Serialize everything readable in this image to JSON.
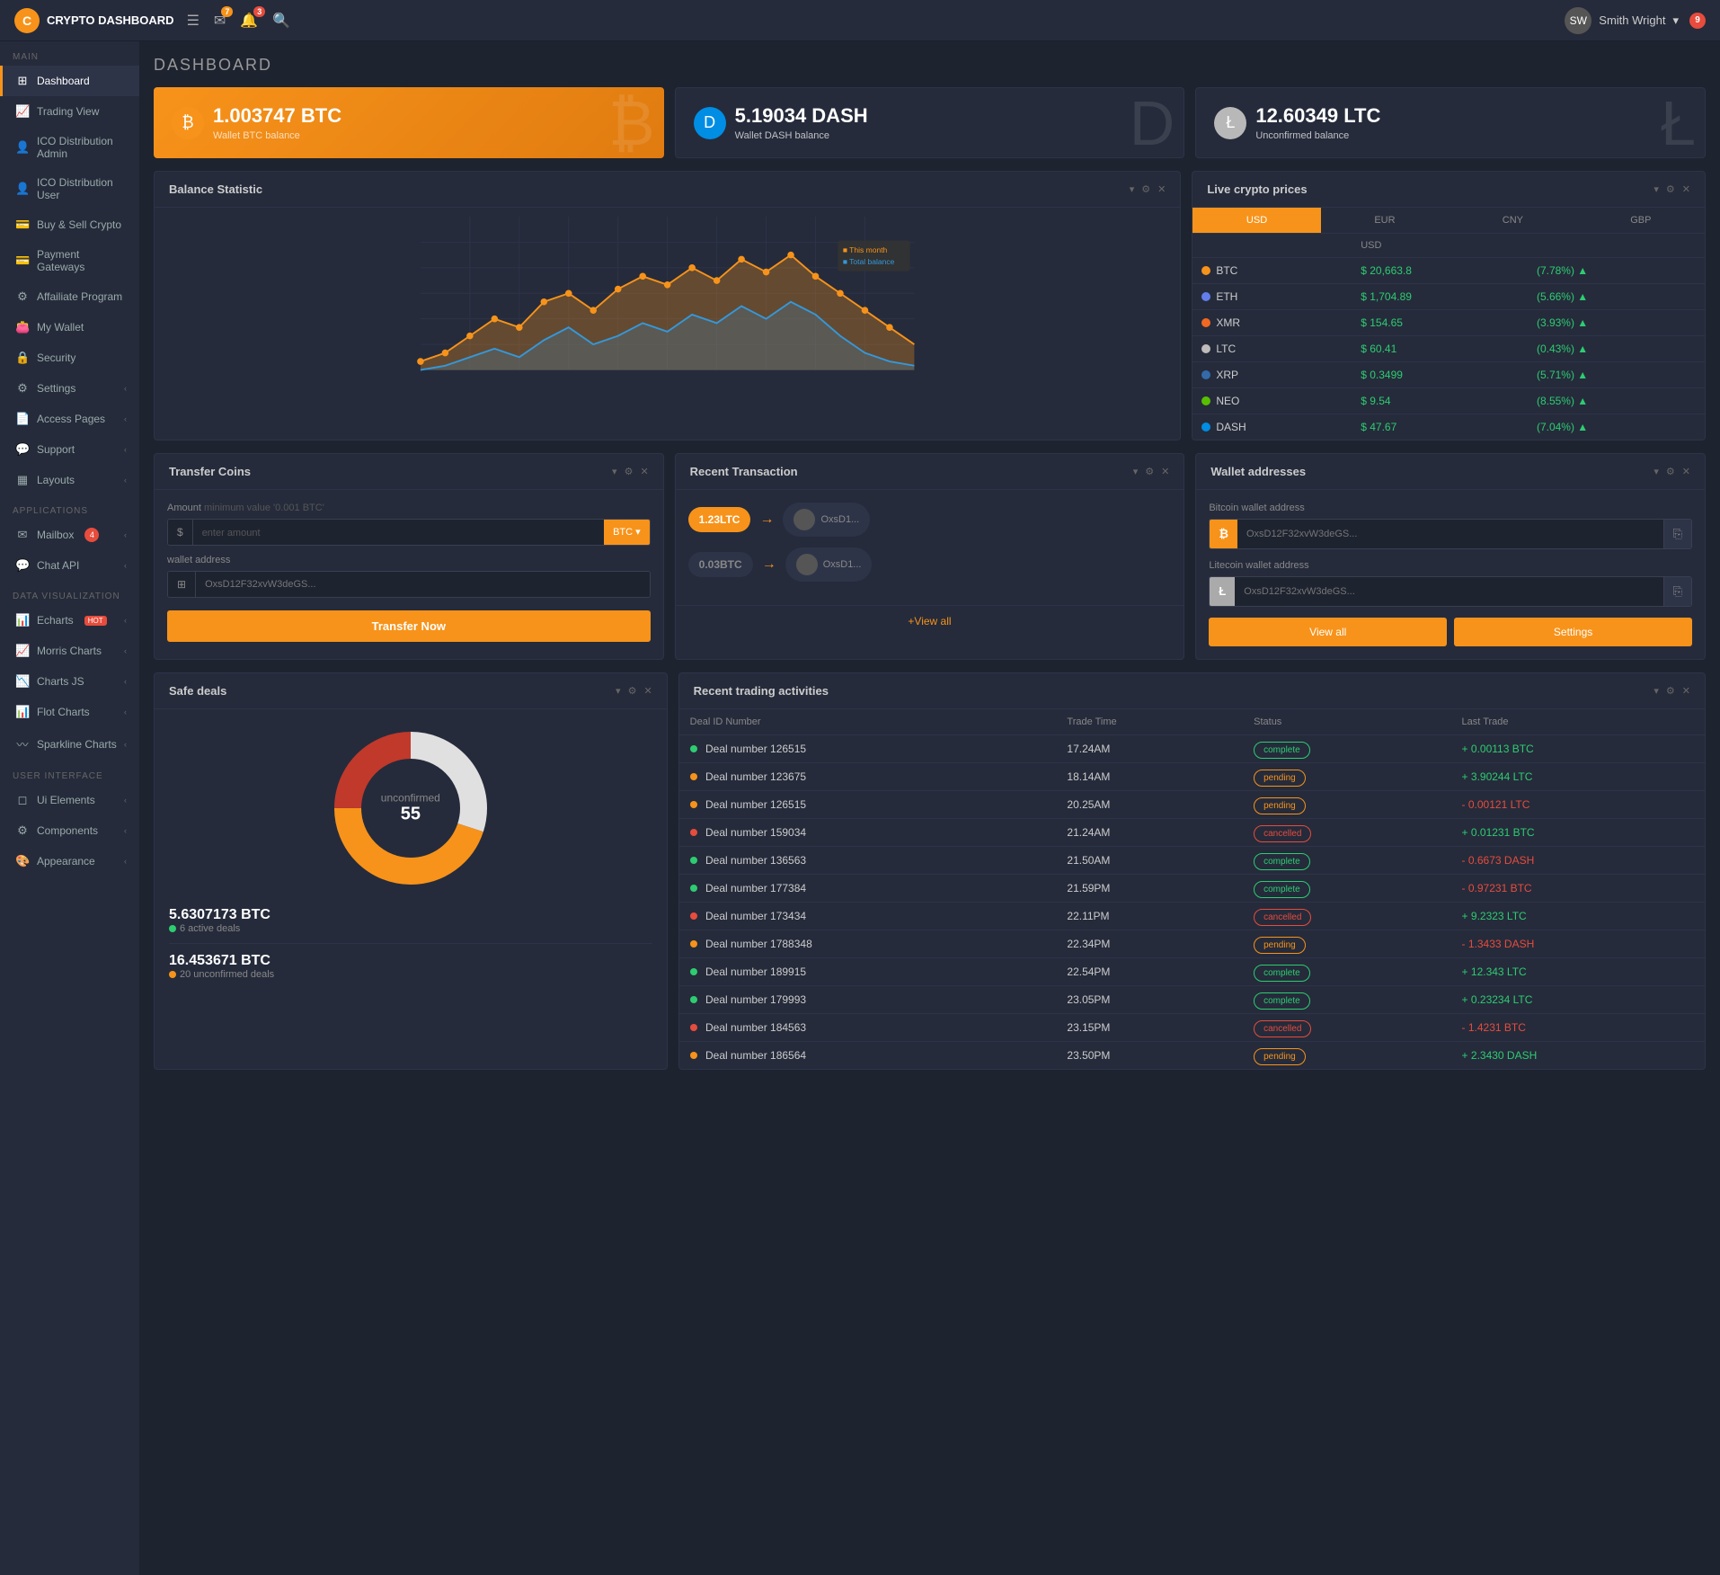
{
  "brand": {
    "name": "CRYPTO DASHBOARD",
    "icon": "C"
  },
  "topnav": {
    "menu_icon": "☰",
    "email_badge": "7",
    "bell_badge": "3",
    "search_icon": "🔍",
    "user_name": "Smith Wright",
    "chat_badge": "9"
  },
  "sidebar": {
    "sections": [
      {
        "label": "MAIN",
        "items": [
          {
            "id": "dashboard",
            "label": "Dashboard",
            "icon": "⊞",
            "active": true
          },
          {
            "id": "trading-view",
            "label": "Trading View",
            "icon": "📈"
          },
          {
            "id": "ico-admin",
            "label": "ICO Distribution Admin",
            "icon": "👤"
          },
          {
            "id": "ico-user",
            "label": "ICO Distribution User",
            "icon": "👤"
          },
          {
            "id": "buy-sell",
            "label": "Buy & Sell Crypto",
            "icon": "💳"
          },
          {
            "id": "payment-gateways",
            "label": "Payment Gateways",
            "icon": "💳"
          },
          {
            "id": "affiliate",
            "label": "Affailiate Program",
            "icon": "⚙"
          },
          {
            "id": "my-wallet",
            "label": "My Wallet",
            "icon": "👛"
          },
          {
            "id": "security",
            "label": "Security",
            "icon": "🔒"
          },
          {
            "id": "settings",
            "label": "Settings",
            "icon": "⚙",
            "has_arrow": true
          },
          {
            "id": "access-pages",
            "label": "Access Pages",
            "icon": "📄",
            "has_arrow": true
          },
          {
            "id": "support",
            "label": "Support",
            "icon": "💬",
            "has_arrow": true
          },
          {
            "id": "layouts",
            "label": "Layouts",
            "icon": "▦",
            "has_arrow": true
          }
        ]
      },
      {
        "label": "APPLICATIONS",
        "items": [
          {
            "id": "mailbox",
            "label": "Mailbox",
            "icon": "✉",
            "badge": "4",
            "has_arrow": true
          },
          {
            "id": "chat-api",
            "label": "Chat API",
            "icon": "💬",
            "has_arrow": true
          }
        ]
      },
      {
        "label": "DATA VISUALIZATION",
        "items": [
          {
            "id": "echarts",
            "label": "Echarts",
            "icon": "📊",
            "hot": true,
            "has_arrow": true
          },
          {
            "id": "morris-charts",
            "label": "Morris Charts",
            "icon": "📈",
            "has_arrow": true
          },
          {
            "id": "charts-js",
            "label": "Charts JS",
            "icon": "📉",
            "has_arrow": true
          },
          {
            "id": "flot-charts",
            "label": "Flot Charts",
            "icon": "📊",
            "has_arrow": true
          },
          {
            "id": "sparkline-charts",
            "label": "Sparkline Charts",
            "icon": "〰",
            "has_arrow": true
          }
        ]
      },
      {
        "label": "USER INTERFACE",
        "items": [
          {
            "id": "ui-elements",
            "label": "Ui Elements",
            "icon": "◻",
            "has_arrow": true
          },
          {
            "id": "components",
            "label": "Components",
            "icon": "⚙",
            "has_arrow": true
          },
          {
            "id": "appearance",
            "label": "Appearance",
            "icon": "🎨",
            "has_arrow": true
          }
        ]
      }
    ]
  },
  "page": {
    "title": "DASHBOARD"
  },
  "stat_cards": [
    {
      "id": "btc",
      "type": "orange",
      "value": "1.003747 BTC",
      "label": "Wallet BTC balance",
      "icon": "₿",
      "bg_icon": "₿"
    },
    {
      "id": "dash",
      "type": "dark",
      "value": "5.19034 DASH",
      "label": "Wallet DASH balance",
      "icon": "D",
      "bg_icon": "D"
    },
    {
      "id": "ltc",
      "type": "dark",
      "value": "12.60349 LTC",
      "label": "Unconfirmed balance",
      "icon": "Ł",
      "bg_icon": "Ł"
    }
  ],
  "balance_statistic": {
    "title": "Balance Statistic",
    "legend": {
      "this_month": "This month",
      "total_balance": "Total balance"
    },
    "controls": [
      "▾",
      "⚙",
      "✕"
    ]
  },
  "live_crypto": {
    "title": "Live crypto prices",
    "tabs": [
      "USD",
      "EUR",
      "CNY",
      "GBP"
    ],
    "active_tab": "USD",
    "columns": [
      "",
      "USD",
      ""
    ],
    "coins": [
      {
        "id": "btc",
        "name": "BTC",
        "dot": "dot-btc",
        "price": "$ 20,663.8",
        "change": "(7.78%) ▲",
        "positive": true
      },
      {
        "id": "eth",
        "name": "ETH",
        "dot": "dot-eth",
        "price": "$ 1,704.89",
        "change": "(5.66%) ▲",
        "positive": true
      },
      {
        "id": "xmr",
        "name": "XMR",
        "dot": "dot-xmr",
        "price": "$ 154.65",
        "change": "(3.93%) ▲",
        "positive": true
      },
      {
        "id": "ltc",
        "name": "LTC",
        "dot": "dot-ltc",
        "price": "$ 60.41",
        "change": "(0.43%) ▲",
        "positive": true
      },
      {
        "id": "xrp",
        "name": "XRP",
        "dot": "dot-xrp",
        "price": "$ 0.3499",
        "change": "(5.71%) ▲",
        "positive": true
      },
      {
        "id": "neo",
        "name": "NEO",
        "dot": "dot-neo",
        "price": "$ 9.54",
        "change": "(8.55%) ▲",
        "positive": true
      },
      {
        "id": "dash",
        "name": "DASH",
        "dot": "dot-dash",
        "price": "$ 47.67",
        "change": "(7.04%) ▲",
        "positive": true
      }
    ]
  },
  "transfer_coins": {
    "title": "Transfer Coins",
    "amount_label": "Amount",
    "amount_hint": "minimum value '0.001 BTC'",
    "prefix": "$",
    "placeholder": "enter amount",
    "currency": "BTC ▾",
    "wallet_placeholder": "OxsD12F32xvW3deGS...",
    "button": "Transfer Now"
  },
  "recent_transaction": {
    "title": "Recent Transaction",
    "transactions": [
      {
        "amount": "1.23LTC",
        "to": "OxsD1..."
      },
      {
        "amount": "0.03BTC",
        "to": "OxsD1..."
      }
    ],
    "view_all": "+View all"
  },
  "wallet_addresses": {
    "title": "Wallet addresses",
    "btc_label": "Bitcoin wallet address",
    "btc_address": "OxsD12F32xvW3deGS...",
    "ltc_label": "Litecoin wallet address",
    "ltc_address": "OxsD12F32xvW3deGS...",
    "view_all": "View all",
    "settings": "Settings"
  },
  "safe_deals": {
    "title": "Safe deals",
    "donut_label": "unconfirmed",
    "donut_value": "55",
    "stats": [
      {
        "btc": "5.6307173 BTC",
        "sub": "6 active deals",
        "dot": "green"
      },
      {
        "btc": "16.453671 BTC",
        "sub": "20 unconfirmed deals",
        "dot": "orange"
      }
    ]
  },
  "trading_activities": {
    "title": "Recent trading activities",
    "columns": [
      "Deal ID Number",
      "Trade Time",
      "Status",
      "Last Trade"
    ],
    "rows": [
      {
        "id": "Deal number 126515",
        "time": "17.24AM",
        "status": "complete",
        "trade": "+ 0.00113 BTC",
        "dot": "green"
      },
      {
        "id": "Deal number 123675",
        "time": "18.14AM",
        "status": "pending",
        "trade": "+ 3.90244 LTC",
        "dot": "orange"
      },
      {
        "id": "Deal number 126515",
        "time": "20.25AM",
        "status": "pending",
        "trade": "- 0.00121 LTC",
        "dot": "orange"
      },
      {
        "id": "Deal number 159034",
        "time": "21.24AM",
        "status": "cancelled",
        "trade": "+ 0.01231 BTC",
        "dot": "red"
      },
      {
        "id": "Deal number 136563",
        "time": "21.50AM",
        "status": "complete",
        "trade": "- 0.6673 DASH",
        "dot": "green"
      },
      {
        "id": "Deal number 177384",
        "time": "21.59PM",
        "status": "complete",
        "trade": "- 0.97231 BTC",
        "dot": "green"
      },
      {
        "id": "Deal number 173434",
        "time": "22.11PM",
        "status": "cancelled",
        "trade": "+ 9.2323 LTC",
        "dot": "red"
      },
      {
        "id": "Deal number 1788348",
        "time": "22.34PM",
        "status": "pending",
        "trade": "- 1.3433 DASH",
        "dot": "orange"
      },
      {
        "id": "Deal number 189915",
        "time": "22.54PM",
        "status": "complete",
        "trade": "+ 12.343 LTC",
        "dot": "green"
      },
      {
        "id": "Deal number 179993",
        "time": "23.05PM",
        "status": "complete",
        "trade": "+ 0.23234 LTC",
        "dot": "green"
      },
      {
        "id": "Deal number 184563",
        "time": "23.15PM",
        "status": "cancelled",
        "trade": "- 1.4231 BTC",
        "dot": "red"
      },
      {
        "id": "Deal number 186564",
        "time": "23.50PM",
        "status": "pending",
        "trade": "+ 2.3430 DASH",
        "dot": "orange"
      }
    ]
  }
}
